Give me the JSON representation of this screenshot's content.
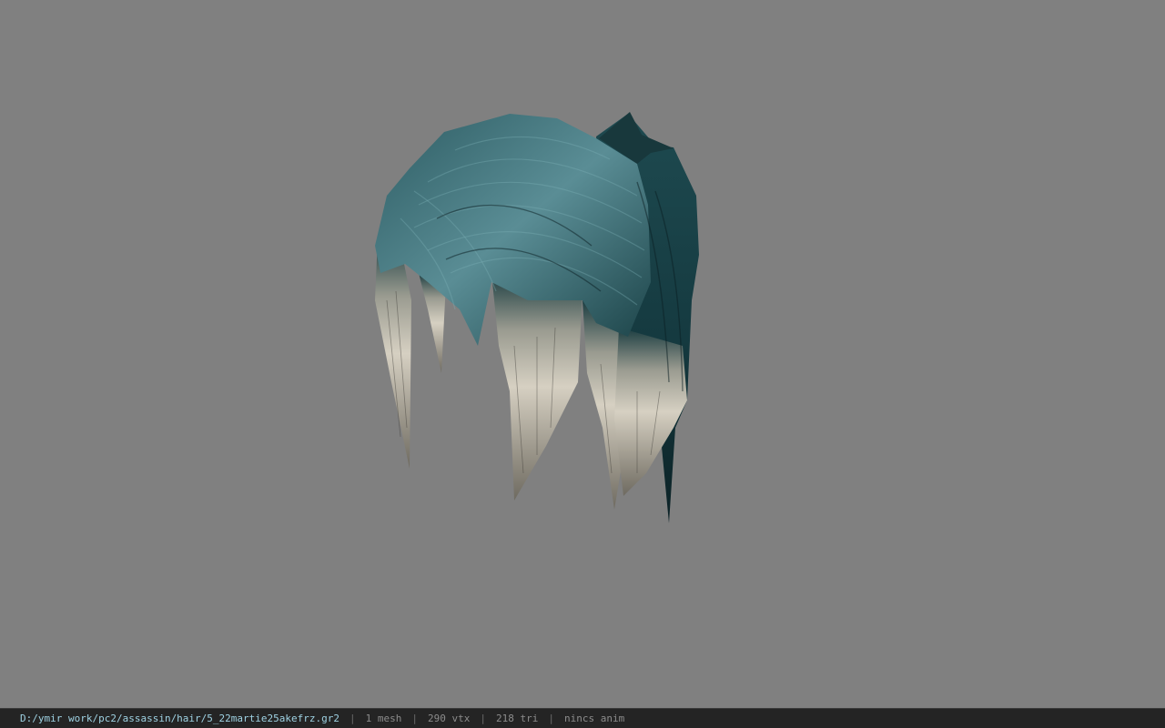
{
  "viewer": {
    "background_color": "#808080",
    "model_description_icon": "hair-model-icon",
    "hair_colors": {
      "dark": "#0f2a2e",
      "mid": "#1e4a50",
      "light": "#4f8088",
      "tip": "#d8d2c4"
    }
  },
  "status_bar": {
    "file_path": "D:/ymir work/pc2/assassin/hair/5_22martie25akefrz.gr2",
    "separator": "|",
    "mesh_count": "1 mesh",
    "vertex_count": "290 vtx",
    "triangle_count": "218 tri",
    "anim_info": "nincs anim"
  }
}
